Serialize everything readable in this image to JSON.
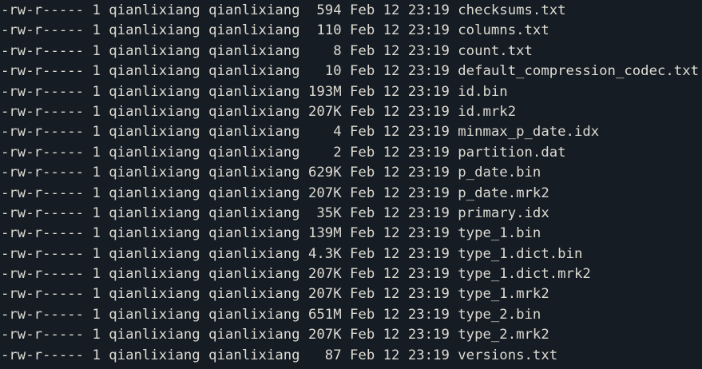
{
  "terminal": {
    "lines": [
      {
        "perms": "-rw-r-----",
        "links": "1",
        "owner": "qianlixiang",
        "group": "qianlixiang",
        "size": "594",
        "date": "Feb 12 23:19",
        "name": "checksums.txt"
      },
      {
        "perms": "-rw-r-----",
        "links": "1",
        "owner": "qianlixiang",
        "group": "qianlixiang",
        "size": "110",
        "date": "Feb 12 23:19",
        "name": "columns.txt"
      },
      {
        "perms": "-rw-r-----",
        "links": "1",
        "owner": "qianlixiang",
        "group": "qianlixiang",
        "size": "8",
        "date": "Feb 12 23:19",
        "name": "count.txt"
      },
      {
        "perms": "-rw-r-----",
        "links": "1",
        "owner": "qianlixiang",
        "group": "qianlixiang",
        "size": "10",
        "date": "Feb 12 23:19",
        "name": "default_compression_codec.txt"
      },
      {
        "perms": "-rw-r-----",
        "links": "1",
        "owner": "qianlixiang",
        "group": "qianlixiang",
        "size": "193M",
        "date": "Feb 12 23:19",
        "name": "id.bin"
      },
      {
        "perms": "-rw-r-----",
        "links": "1",
        "owner": "qianlixiang",
        "group": "qianlixiang",
        "size": "207K",
        "date": "Feb 12 23:19",
        "name": "id.mrk2"
      },
      {
        "perms": "-rw-r-----",
        "links": "1",
        "owner": "qianlixiang",
        "group": "qianlixiang",
        "size": "4",
        "date": "Feb 12 23:19",
        "name": "minmax_p_date.idx"
      },
      {
        "perms": "-rw-r-----",
        "links": "1",
        "owner": "qianlixiang",
        "group": "qianlixiang",
        "size": "2",
        "date": "Feb 12 23:19",
        "name": "partition.dat"
      },
      {
        "perms": "-rw-r-----",
        "links": "1",
        "owner": "qianlixiang",
        "group": "qianlixiang",
        "size": "629K",
        "date": "Feb 12 23:19",
        "name": "p_date.bin"
      },
      {
        "perms": "-rw-r-----",
        "links": "1",
        "owner": "qianlixiang",
        "group": "qianlixiang",
        "size": "207K",
        "date": "Feb 12 23:19",
        "name": "p_date.mrk2"
      },
      {
        "perms": "-rw-r-----",
        "links": "1",
        "owner": "qianlixiang",
        "group": "qianlixiang",
        "size": "35K",
        "date": "Feb 12 23:19",
        "name": "primary.idx"
      },
      {
        "perms": "-rw-r-----",
        "links": "1",
        "owner": "qianlixiang",
        "group": "qianlixiang",
        "size": "139M",
        "date": "Feb 12 23:19",
        "name": "type_1.bin"
      },
      {
        "perms": "-rw-r-----",
        "links": "1",
        "owner": "qianlixiang",
        "group": "qianlixiang",
        "size": "4.3K",
        "date": "Feb 12 23:19",
        "name": "type_1.dict.bin"
      },
      {
        "perms": "-rw-r-----",
        "links": "1",
        "owner": "qianlixiang",
        "group": "qianlixiang",
        "size": "207K",
        "date": "Feb 12 23:19",
        "name": "type_1.dict.mrk2"
      },
      {
        "perms": "-rw-r-----",
        "links": "1",
        "owner": "qianlixiang",
        "group": "qianlixiang",
        "size": "207K",
        "date": "Feb 12 23:19",
        "name": "type_1.mrk2"
      },
      {
        "perms": "-rw-r-----",
        "links": "1",
        "owner": "qianlixiang",
        "group": "qianlixiang",
        "size": "651M",
        "date": "Feb 12 23:19",
        "name": "type_2.bin"
      },
      {
        "perms": "-rw-r-----",
        "links": "1",
        "owner": "qianlixiang",
        "group": "qianlixiang",
        "size": "207K",
        "date": "Feb 12 23:19",
        "name": "type_2.mrk2"
      },
      {
        "perms": "-rw-r-----",
        "links": "1",
        "owner": "qianlixiang",
        "group": "qianlixiang",
        "size": "87",
        "date": "Feb 12 23:19",
        "name": "versions.txt"
      }
    ]
  },
  "colors": {
    "background": "#151c24",
    "text": "#dedbd2"
  }
}
